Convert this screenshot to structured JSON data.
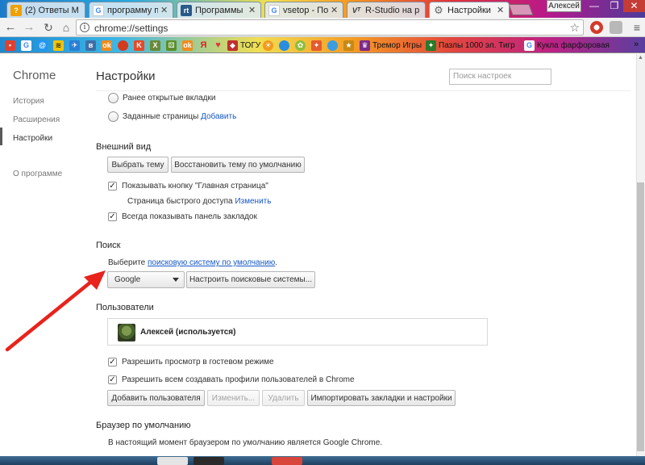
{
  "browser": {
    "tabs": [
      {
        "title": "(2) Ответы M",
        "icon": "question-icon",
        "color": "#f0a000"
      },
      {
        "title": "программу п",
        "icon": "google-g-icon",
        "color": "#4285f4"
      },
      {
        "title": "Программы",
        "icon": "rt-icon",
        "color": "#2a5a8a"
      },
      {
        "title": "vsetop - Пои",
        "icon": "google-g-icon",
        "color": "#4285f4"
      },
      {
        "title": "R-Studio на р",
        "icon": "vt-icon",
        "color": "#555555"
      },
      {
        "title": "Настройки",
        "icon": "gear-icon",
        "color": "#666666",
        "active": true
      }
    ],
    "user_badge": "Алексей",
    "window_controls": {
      "minimize": "—",
      "maximize": "❐",
      "close": "✕"
    },
    "address": "chrome://settings",
    "bookmarks": [
      {
        "label": "",
        "icon": "apps-icon",
        "color": "#e04030"
      },
      {
        "label": "",
        "icon": "google-g-icon",
        "color": "#4285f4"
      },
      {
        "label": "",
        "icon": "mail-icon",
        "color": "#2196f3"
      },
      {
        "label": "",
        "icon": "beeline-icon",
        "color": "#f5c400"
      },
      {
        "label": "",
        "icon": "bird-icon",
        "color": "#2a7fd4"
      },
      {
        "label": "",
        "icon": "vk-icon",
        "color": "#3f6fa6"
      },
      {
        "label": "",
        "icon": "ok-icon",
        "color": "#f08c1e"
      },
      {
        "label": "",
        "icon": "dot-icon",
        "color": "#d43a20"
      },
      {
        "label": "",
        "icon": "letter-k-icon",
        "color": "#e44b2a"
      },
      {
        "label": "",
        "icon": "xo-icon",
        "color": "#6a8a3a"
      },
      {
        "label": "",
        "icon": "dice-icon",
        "color": "#5b8f2b"
      },
      {
        "label": "",
        "icon": "ok-icon",
        "color": "#f08c1e"
      },
      {
        "label": "",
        "icon": "yandex-icon",
        "color": "#e02020"
      },
      {
        "label": "",
        "icon": "heart-icon",
        "color": "#d93b3b"
      },
      {
        "label": "ТОГУ",
        "icon": "shield-icon",
        "color": "#c03030"
      },
      {
        "label": "",
        "icon": "sun-icon",
        "color": "#f19a1c"
      },
      {
        "label": "",
        "icon": "dot-icon",
        "color": "#2b8de0"
      },
      {
        "label": "",
        "icon": "flower-icon",
        "color": "#8cbe3c"
      },
      {
        "label": "",
        "icon": "puzzle-icon",
        "color": "#e65a30"
      },
      {
        "label": "",
        "icon": "blob-icon",
        "color": "#3a9de0"
      },
      {
        "label": "",
        "icon": "star-icon",
        "color": "#c58a14"
      },
      {
        "label": "Тремор Игры",
        "icon": "crown-icon",
        "color": "#7c2a8a"
      },
      {
        "label": "Пазлы 1000 эл. Тигр",
        "icon": "puzzle-icon",
        "color": "#2a7a2a"
      },
      {
        "label": "Кукла фарфоровая",
        "icon": "google-g-icon",
        "color": "#4285f4"
      }
    ],
    "bookmarks_more": "»"
  },
  "sidebar": {
    "title": "Chrome",
    "items": [
      "История",
      "Расширения",
      "Настройки",
      "О программе"
    ],
    "active": "Настройки"
  },
  "settings": {
    "title": "Настройки",
    "search_placeholder": "Поиск настроек",
    "startup": {
      "option_previous": "Ранее открытые вкладки",
      "option_pages": "Заданные страницы",
      "add_link": "Добавить"
    },
    "appearance": {
      "title": "Внешний вид",
      "choose_theme": "Выбрать тему",
      "reset_theme": "Восстановить тему по умолчанию",
      "show_home": "Показывать кнопку \"Главная страница\"",
      "quick_access": "Страница быстрого доступа",
      "change_link": "Изменить",
      "show_bookmarks_bar": "Всегда показывать панель закладок"
    },
    "search": {
      "title": "Поиск",
      "prompt_prefix": "Выберите",
      "prompt_link": "поисковую систему по умолчанию",
      "prompt_suffix": ".",
      "engine": "Google",
      "manage_button": "Настроить поисковые системы..."
    },
    "users": {
      "title": "Пользователи",
      "current_user": "Алексей (используется)",
      "guest_mode": "Разрешить просмотр в гостевом режиме",
      "allow_profiles": "Разрешить всем создавать профили пользователей в Chrome",
      "add_user": "Добавить пользователя",
      "edit": "Изменить...",
      "delete": "Удалить",
      "import": "Импортировать закладки и настройки"
    },
    "default_browser": {
      "title": "Браузер по умолчанию",
      "status": "В настоящий момент браузером по умолчанию является Google Chrome."
    }
  },
  "annotation": {
    "arrow_color": "#e8231c"
  },
  "colors": {
    "link": "#1558c6",
    "accent_close": "#c43c35"
  }
}
